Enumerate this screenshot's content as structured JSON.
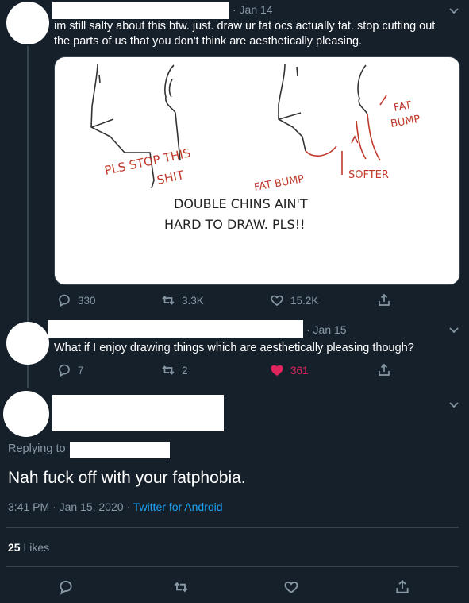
{
  "tweet1": {
    "date": "· Jan 14",
    "text_line1": "im still salty about this btw. just. draw ur fat ocs actually fat. stop cutting out",
    "text_line2": "the parts of us that you don't think are aesthetically pleasing.",
    "image_text": {
      "pls_stop": "PLS STOP THIS",
      "shit": "SHIT",
      "fat_bump_chin": "FAT BUMP",
      "softer": "SOFTER",
      "fat_bump_neck": "FAT",
      "fat_bump_neck2": "BUMP",
      "caption1": "DOUBLE CHINS AIN'T",
      "caption2": "HARD TO DRAW. PLS!!"
    },
    "replies": "330",
    "retweets": "3.3K",
    "likes": "15.2K",
    "icons": [
      "reply-icon",
      "retweet-icon",
      "like-icon",
      "share-icon",
      "chevron-down-icon"
    ]
  },
  "tweet2": {
    "date": "· Jan 15",
    "text": "What if I enjoy drawing things which are aesthetically pleasing though?",
    "replies": "7",
    "retweets": "2",
    "likes": "361",
    "liked_color": "#e0245e"
  },
  "tweet3": {
    "replying_label": "Replying to",
    "text": "Nah fuck off with your fatphobia.",
    "timestamp": "3:41 PM · Jan 15, 2020 ·",
    "source": "Twitter for Android",
    "like_count": "25",
    "like_label": "Likes",
    "link_color": "#1da1f2"
  }
}
